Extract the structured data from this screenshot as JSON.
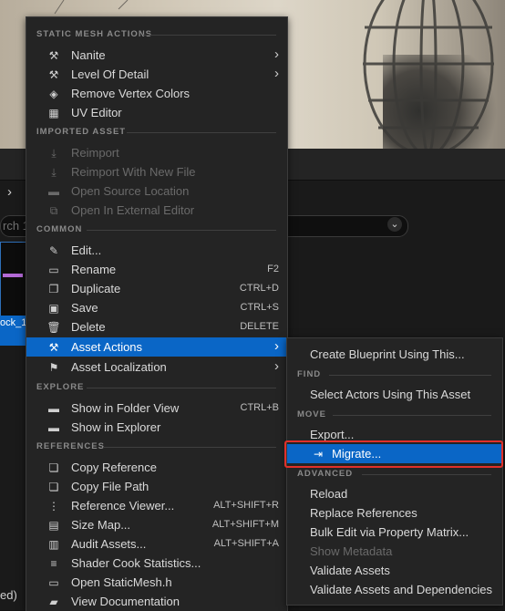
{
  "background": {
    "search_placeholder": "rch 1",
    "asset_label": "ock_1",
    "status_text": "ed)"
  },
  "main_menu": {
    "sections": [
      {
        "title": "STATIC MESH ACTIONS",
        "items": [
          {
            "label": "Nanite",
            "icon": "wrench-icon",
            "submenu": true
          },
          {
            "label": "Level Of Detail",
            "icon": "wrench-icon",
            "submenu": true
          },
          {
            "label": "Remove Vertex Colors",
            "icon": "paint-remove-icon"
          },
          {
            "label": "UV Editor",
            "icon": "grid-icon"
          }
        ]
      },
      {
        "title": "IMPORTED ASSET",
        "items": [
          {
            "label": "Reimport",
            "icon": "import-icon",
            "disabled": true
          },
          {
            "label": "Reimport With New File",
            "icon": "import-icon",
            "disabled": true
          },
          {
            "label": "Open Source Location",
            "icon": "folder-icon",
            "disabled": true
          },
          {
            "label": "Open In External Editor",
            "icon": "external-icon",
            "disabled": true
          }
        ]
      },
      {
        "title": "COMMON",
        "items": [
          {
            "label": "Edit...",
            "icon": "pencil-icon"
          },
          {
            "label": "Rename",
            "icon": "rename-icon",
            "shortcut": "F2"
          },
          {
            "label": "Duplicate",
            "icon": "duplicate-icon",
            "shortcut": "CTRL+D"
          },
          {
            "label": "Save",
            "icon": "save-icon",
            "shortcut": "CTRL+S"
          },
          {
            "label": "Delete",
            "icon": "trash-icon",
            "shortcut": "DELETE"
          },
          {
            "label": "Asset Actions",
            "icon": "wrench-icon",
            "submenu": true,
            "active": true
          },
          {
            "label": "Asset Localization",
            "icon": "flag-icon",
            "submenu": true
          }
        ]
      },
      {
        "title": "EXPLORE",
        "items": [
          {
            "label": "Show in Folder View",
            "icon": "folder-icon",
            "shortcut": "CTRL+B"
          },
          {
            "label": "Show in Explorer",
            "icon": "folder-icon"
          }
        ]
      },
      {
        "title": "REFERENCES",
        "items": [
          {
            "label": "Copy Reference",
            "icon": "copy-icon"
          },
          {
            "label": "Copy File Path",
            "icon": "copy-icon"
          },
          {
            "label": "Reference Viewer...",
            "icon": "reference-viewer-icon",
            "shortcut": "ALT+SHIFT+R"
          },
          {
            "label": "Size Map...",
            "icon": "size-map-icon",
            "shortcut": "ALT+SHIFT+M"
          },
          {
            "label": "Audit Assets...",
            "icon": "audit-icon",
            "shortcut": "ALT+SHIFT+A"
          },
          {
            "label": "Shader Cook Statistics...",
            "icon": "stats-icon"
          },
          {
            "label": "Open StaticMesh.h",
            "icon": "code-file-icon"
          },
          {
            "label": "View Documentation",
            "icon": "book-icon"
          }
        ]
      }
    ]
  },
  "sub_menu": {
    "top_item": "Create Blueprint Using This...",
    "find_title": "FIND",
    "find_item": "Select Actors Using This Asset",
    "move_title": "MOVE",
    "export_item": "Export...",
    "migrate_item": "Migrate...",
    "advanced_title": "ADVANCED",
    "advanced_items": [
      {
        "label": "Reload"
      },
      {
        "label": "Replace References"
      },
      {
        "label": "Bulk Edit via Property Matrix..."
      },
      {
        "label": "Show Metadata",
        "disabled": true
      },
      {
        "label": "Validate Assets"
      },
      {
        "label": "Validate Assets and Dependencies"
      }
    ]
  },
  "colors": {
    "accent": "#0a66c6",
    "highlight_border": "#e0302a",
    "menu_bg": "#242424"
  }
}
